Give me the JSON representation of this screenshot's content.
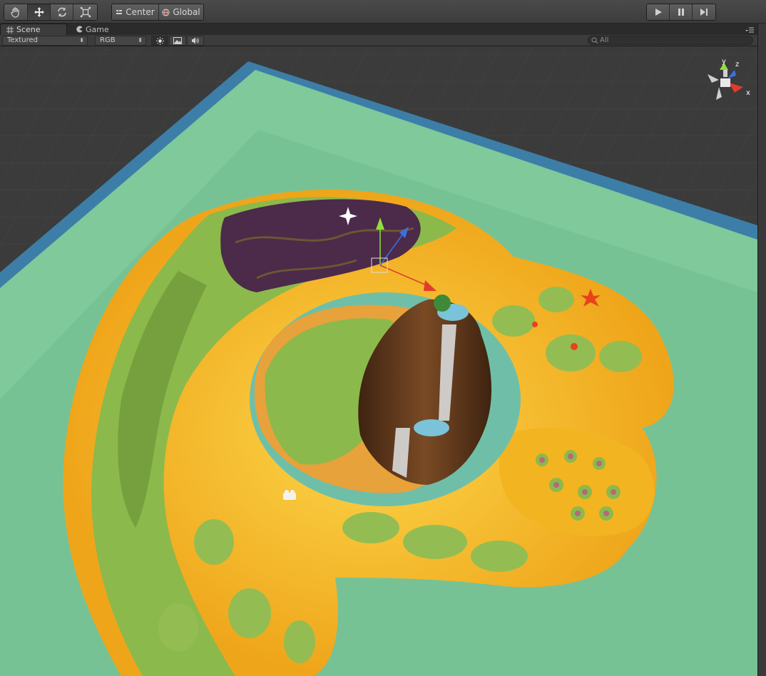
{
  "toolbar": {
    "tools": [
      {
        "name": "hand-tool-button",
        "icon": "hand-icon"
      },
      {
        "name": "move-tool-button",
        "icon": "move-arrows-icon",
        "active": true
      },
      {
        "name": "rotate-tool-button",
        "icon": "rotate-icon"
      },
      {
        "name": "scale-tool-button",
        "icon": "scale-icon"
      }
    ],
    "pivot_mode_label": "Center",
    "pivot_rotation_label": "Global",
    "playback": [
      "play-icon",
      "pause-icon",
      "step-icon"
    ]
  },
  "tabs": [
    {
      "label": "Scene",
      "icon": "grid-icon",
      "active": true
    },
    {
      "label": "Game",
      "icon": "pacman-icon",
      "active": false
    }
  ],
  "scene_bar": {
    "render_mode": "Textured",
    "color_mode": "RGB",
    "toggles": [
      "sun-lighting-icon",
      "image-effects-icon",
      "audio-icon"
    ],
    "search_placeholder": "All"
  },
  "gizmo": {
    "axis_labels": {
      "y": "y",
      "z": "z",
      "x": "x"
    },
    "colors": {
      "y": "#8fe03c",
      "z": "#3c6fe0",
      "x": "#e03c2c"
    }
  },
  "colors": {
    "toolbar_bg": "#3e3e3e",
    "viewport_bg": "#3b3b3b",
    "water_deep": "#3c7ea8",
    "water_shallow": "#7fc99a",
    "sand": "#f1b21d",
    "grass": "#8cb94b",
    "purple_forest": "#4b2a4a",
    "cliff": "#6b3f1e",
    "pond": "#7ac3d8"
  }
}
